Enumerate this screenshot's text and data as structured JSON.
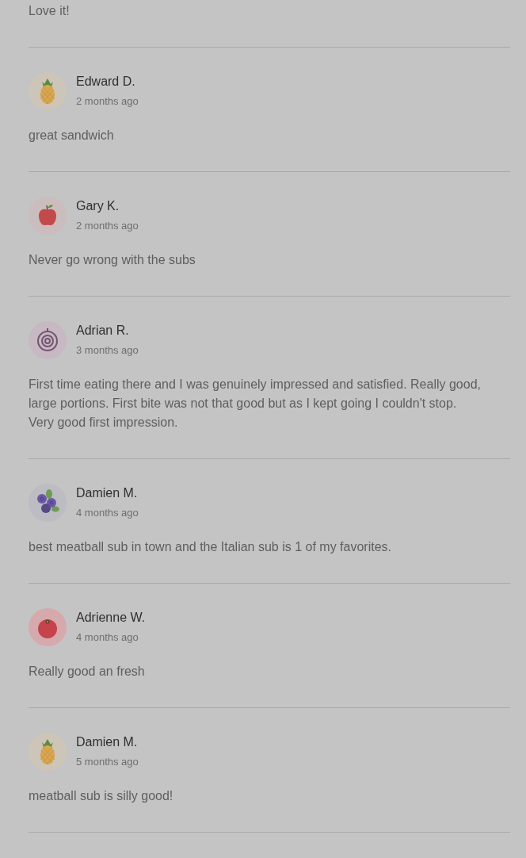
{
  "reviews": [
    {
      "text": "Love it!"
    },
    {
      "name": "Edward D.",
      "time": "2 months ago",
      "avatar": {
        "kind": "pineapple"
      },
      "text": "great sandwich"
    },
    {
      "name": "Gary K.",
      "time": "2 months ago",
      "avatar": {
        "kind": "apple"
      },
      "text": "Never go wrong with the subs"
    },
    {
      "name": "Adrian R.",
      "time": "3 months ago",
      "avatar": {
        "kind": "onion"
      },
      "text": "First time eating there and I was genuinely impressed and satisfied. Really good, large portions. First bite was not that good but as I kept going I couldn't stop. Very good first impression."
    },
    {
      "name": "Damien M.",
      "time": "4 months ago",
      "avatar": {
        "kind": "blueberries"
      },
      "text": "best meatball sub in town and the Italian sub is 1 of my favorites."
    },
    {
      "name": "Adrienne W.",
      "time": "4 months ago",
      "avatar": {
        "kind": "berry"
      },
      "text": "Really good an fresh"
    },
    {
      "name": "Damien M.",
      "time": "5 months ago",
      "avatar": {
        "kind": "pineapple"
      },
      "text": "meatball sub is silly good!"
    }
  ]
}
